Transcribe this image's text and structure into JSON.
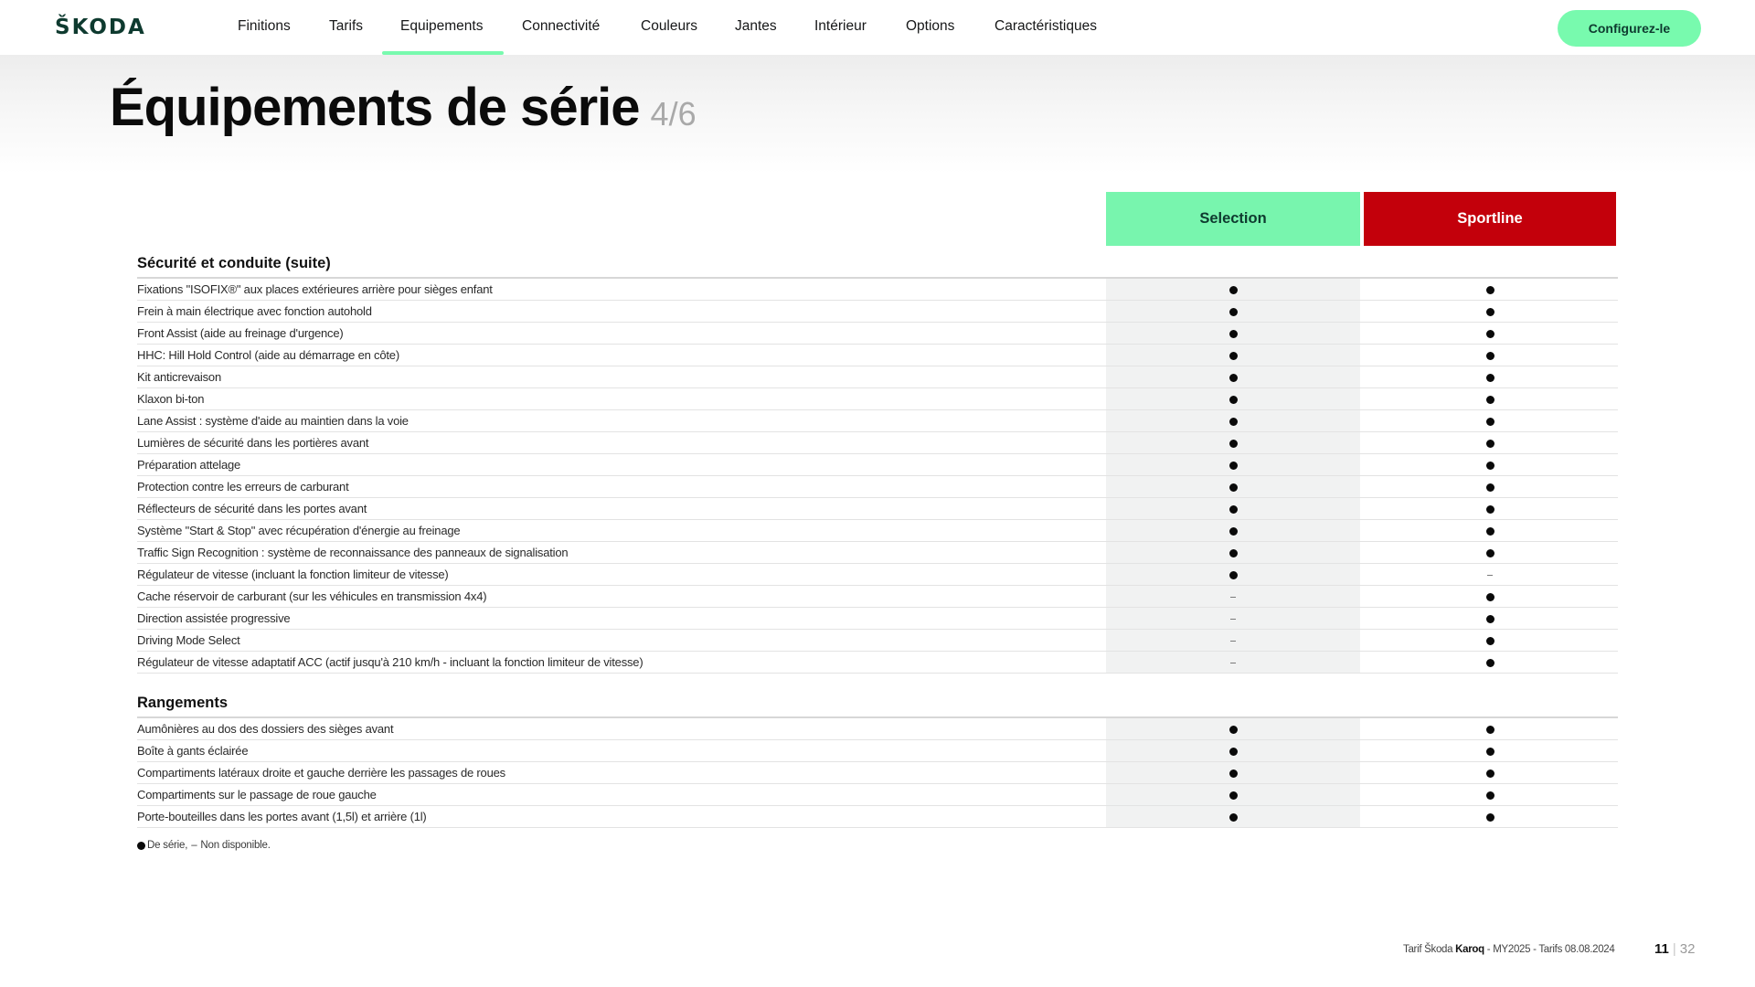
{
  "brand": {
    "logo_text": "ŠKODA",
    "accent_color": "#78faae",
    "dark_green": "#0e3a2f"
  },
  "nav": {
    "items": [
      {
        "label": "Finitions",
        "active": false
      },
      {
        "label": "Tarifs",
        "active": false
      },
      {
        "label": "Equipements",
        "active": true
      },
      {
        "label": "Connectivité",
        "active": false
      },
      {
        "label": "Couleurs",
        "active": false
      },
      {
        "label": "Jantes",
        "active": false
      },
      {
        "label": "Intérieur",
        "active": false
      },
      {
        "label": "Options",
        "active": false
      },
      {
        "label": "Caractéristiques",
        "active": false
      }
    ],
    "cta_label": "Configurez-le"
  },
  "page": {
    "title": "Équipements de série",
    "subpage": "4/6"
  },
  "columns": [
    {
      "label": "Selection",
      "color": "#78f5ae",
      "text_color": "#0e3a2f"
    },
    {
      "label": "Sportline",
      "color": "#c3000b",
      "text_color": "#ffffff"
    }
  ],
  "sections": [
    {
      "title": "Sécurité et conduite (suite)",
      "rows": [
        {
          "label": "Fixations \"ISOFIX®\" aux places extérieures arrière pour sièges enfant",
          "selection": "standard",
          "sportline": "standard"
        },
        {
          "label": "Frein à main électrique avec fonction autohold",
          "selection": "standard",
          "sportline": "standard"
        },
        {
          "label": "Front Assist (aide au freinage d'urgence)",
          "selection": "standard",
          "sportline": "standard"
        },
        {
          "label": "HHC: Hill Hold Control (aide au démarrage en côte)",
          "selection": "standard",
          "sportline": "standard"
        },
        {
          "label": "Kit anticrevaison",
          "selection": "standard",
          "sportline": "standard"
        },
        {
          "label": "Klaxon bi-ton",
          "selection": "standard",
          "sportline": "standard"
        },
        {
          "label": "Lane Assist : système d'aide au maintien dans la voie",
          "selection": "standard",
          "sportline": "standard"
        },
        {
          "label": "Lumières de sécurité dans les portières avant",
          "selection": "standard",
          "sportline": "standard"
        },
        {
          "label": "Préparation attelage",
          "selection": "standard",
          "sportline": "standard"
        },
        {
          "label": "Protection contre les erreurs de carburant",
          "selection": "standard",
          "sportline": "standard"
        },
        {
          "label": "Réflecteurs de sécurité dans les portes avant",
          "selection": "standard",
          "sportline": "standard"
        },
        {
          "label": "Système \"Start & Stop\" avec récupération d'énergie au freinage",
          "selection": "standard",
          "sportline": "standard"
        },
        {
          "label": "Traffic Sign Recognition : système de reconnaissance des panneaux de signalisation",
          "selection": "standard",
          "sportline": "standard"
        },
        {
          "label": "Régulateur de vitesse (incluant la fonction limiteur de vitesse)",
          "selection": "standard",
          "sportline": "unavailable"
        },
        {
          "label": "Cache réservoir de carburant (sur les véhicules en transmission 4x4)",
          "selection": "unavailable",
          "sportline": "standard"
        },
        {
          "label": "Direction assistée progressive",
          "selection": "unavailable",
          "sportline": "standard"
        },
        {
          "label": "Driving Mode Select",
          "selection": "unavailable",
          "sportline": "standard"
        },
        {
          "label": "Régulateur de vitesse adaptatif ACC (actif jusqu'à 210 km/h - incluant la fonction limiteur de vitesse)",
          "selection": "unavailable",
          "sportline": "standard"
        }
      ]
    },
    {
      "title": "Rangements",
      "rows": [
        {
          "label": "Aumônières au dos des dossiers des sièges avant",
          "selection": "standard",
          "sportline": "standard"
        },
        {
          "label": "Boîte à gants éclairée",
          "selection": "standard",
          "sportline": "standard"
        },
        {
          "label": "Compartiments latéraux droite et gauche derrière les passages de roues",
          "selection": "standard",
          "sportline": "standard"
        },
        {
          "label": "Compartiments sur le passage de roue gauche",
          "selection": "standard",
          "sportline": "standard"
        },
        {
          "label": "Porte-bouteilles dans les portes avant (1,5l) et arrière (1l)",
          "selection": "standard",
          "sportline": "standard"
        }
      ]
    }
  ],
  "legend": {
    "standard_label": "De série,",
    "unavailable_symbol": "–",
    "unavailable_label": "Non disponible."
  },
  "footer": {
    "prefix": "Tarif Škoda",
    "model": "Karoq",
    "suffix": "- MY2025 - Tarifs 08.08.2024",
    "page_current": "11",
    "page_separator": "|",
    "page_total": "32"
  }
}
